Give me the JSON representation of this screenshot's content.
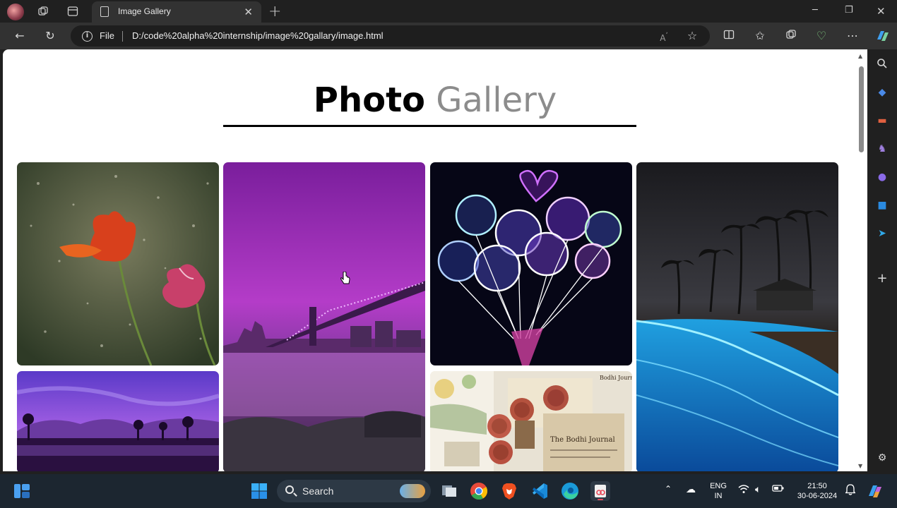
{
  "browser": {
    "tab_title": "Image Gallery",
    "address_label": "File",
    "url": "D:/code%20alpha%20internship/image%20gallary/image.html"
  },
  "page": {
    "heading_bold": "Photo",
    "heading_light": "Gallery"
  },
  "gallery": {
    "photos": [
      {
        "name": "tulips-in-rain"
      },
      {
        "name": "purple-city-bridge"
      },
      {
        "name": "glowing-heart-balloons"
      },
      {
        "name": "night-beach-bioluminescence"
      },
      {
        "name": "purple-sunset-landscape"
      },
      {
        "name": "journal-stamps-collage"
      }
    ]
  },
  "taskbar": {
    "search_placeholder": "Search",
    "lang_line1": "ENG",
    "lang_line2": "IN",
    "time": "21:50",
    "date": "30-06-2024"
  },
  "colors": {
    "browser_chrome": "#202020",
    "toolbar": "#323232",
    "page_background": "#ffffff",
    "heading_light": "#8c8c8c",
    "taskbar": "#1c2630"
  }
}
